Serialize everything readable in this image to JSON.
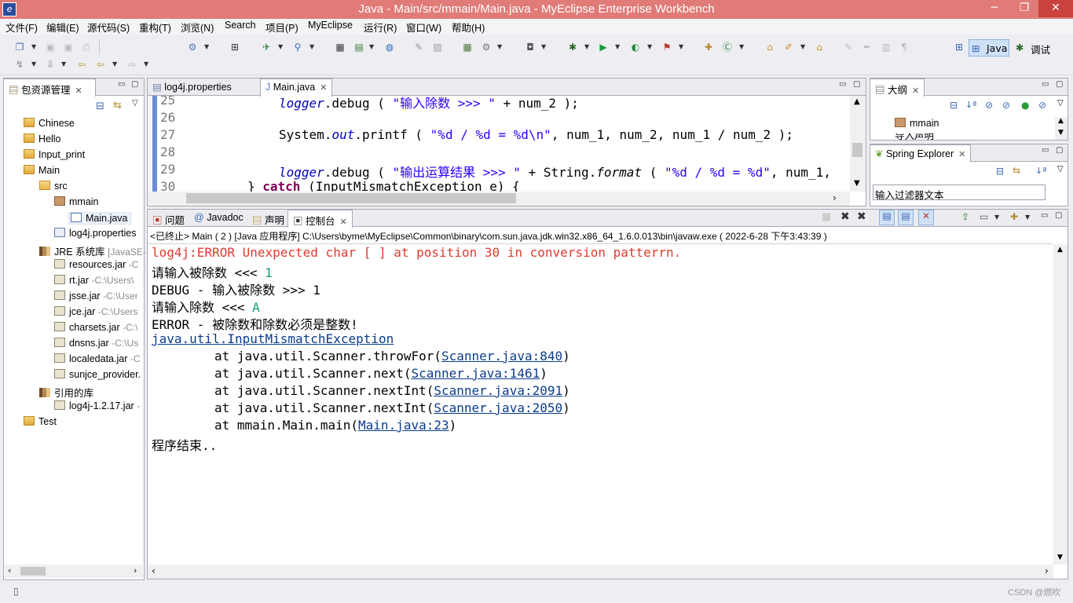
{
  "window": {
    "title": "Java  -  Main/src/mmain/Main.java  -  MyEclipse Enterprise Workbench",
    "min": "─",
    "max": "❐",
    "close": "✕"
  },
  "menu": [
    "文件(F)",
    "编辑(E)",
    "源代码(S)",
    "重构(T)",
    "浏览(N)",
    "Search",
    "项目(P)",
    "MyEclipse",
    "运行(R)",
    "窗口(W)",
    "帮助(H)"
  ],
  "perspectives": {
    "java": "Java",
    "debug": "调试"
  },
  "package_explorer": {
    "tab": "包资源管理",
    "items": [
      {
        "label": "Chinese",
        "icon": "project-icon"
      },
      {
        "label": "Hello",
        "icon": "project-icon"
      },
      {
        "label": "Input_print",
        "icon": "project-icon"
      },
      {
        "label": "Main",
        "icon": "project-icon"
      },
      {
        "label": "src",
        "icon": "source-folder-icon"
      },
      {
        "label": "mmain",
        "icon": "package-icon"
      },
      {
        "label": "Main.java",
        "icon": "java-file-icon"
      },
      {
        "label": "log4j.properties",
        "icon": "properties-file-icon"
      },
      {
        "label": "JRE 系统库",
        "suffix": "[JavaSE-",
        "icon": "library-icon"
      },
      {
        "label": "resources.jar",
        "suffix": "-C",
        "icon": "jar-icon"
      },
      {
        "label": "rt.jar",
        "suffix": "-C:\\Users\\",
        "icon": "jar-icon"
      },
      {
        "label": "jsse.jar",
        "suffix": "-C:\\User",
        "icon": "jar-icon"
      },
      {
        "label": "jce.jar",
        "suffix": "-C:\\Users",
        "icon": "jar-icon"
      },
      {
        "label": "charsets.jar",
        "suffix": "-C:\\",
        "icon": "jar-icon"
      },
      {
        "label": "dnsns.jar",
        "suffix": "-C:\\Us",
        "icon": "jar-icon"
      },
      {
        "label": "localedata.jar",
        "suffix": "-C",
        "icon": "jar-icon"
      },
      {
        "label": "sunjce_provider.",
        "suffix": "",
        "icon": "jar-icon"
      },
      {
        "label": "引用的库",
        "icon": "library-icon"
      },
      {
        "label": "log4j-1.2.17.jar",
        "suffix": "-",
        "icon": "jar-icon"
      },
      {
        "label": "Test",
        "icon": "project-icon"
      }
    ]
  },
  "editor": {
    "tabs": [
      "log4j.properties",
      "Main.java"
    ],
    "line_numbers": [
      "25",
      "26",
      "27",
      "28",
      "29",
      "30"
    ],
    "lines": {
      "l25_field": "logger",
      "l25_a": ".debug ( ",
      "l25_str": "\"输入除数 >>> \"",
      "l25_b": " + num_2 );",
      "l27_a": "System.",
      "l27_field": "out",
      "l27_b": ".printf ( ",
      "l27_str": "\"%d / %d = %d\\n\"",
      "l27_c": ", num_1, num_2, num_1 / num_2 );",
      "l29_field": "logger",
      "l29_a": ".debug ( ",
      "l29_str": "\"输出运算结果 >>> \"",
      "l29_b": " + String.",
      "l29_method": "format",
      "l29_c": " ( ",
      "l29_str2": "\"%d / %d = %d\"",
      "l29_d": ", num_1,",
      "l30_a": "} ",
      "l30_kw": "catch",
      "l30_b": " (InputMismatchException e) {"
    }
  },
  "outline": {
    "tab": "大纲",
    "item": "mmain",
    "item2": "导入声明"
  },
  "spring": {
    "tab": "Spring Explorer",
    "filter_placeholder": "输入过滤器文本"
  },
  "bottom_tabs": [
    "问题",
    "Javadoc",
    "声明",
    "控制台"
  ],
  "console": {
    "header": "<已终止> Main ( 2 ) [Java 应用程序] C:\\Users\\byme\\MyEclipse\\Common\\binary\\com.sun.java.jdk.win32.x86_64_1.6.0.013\\bin\\javaw.exe ( 2022-6-28 下午3:43:39 )",
    "l1": "log4j:ERROR Unexpected char [ ] at position 30 in conversion patterrn.",
    "l2_prompt": "请输入被除数 <<< ",
    "l2_input": "1",
    "l3": "DEBUG - 输入被除数 >>> 1",
    "l4_prompt": "请输入除数 <<< ",
    "l4_input": "A",
    "l5": "ERROR - 被除数和除数必须是整数!",
    "l6": "java.util.InputMismatchException",
    "trace": [
      {
        "pre": "\tat java.util.Scanner.throwFor(",
        "link": "Scanner.java:840",
        "post": ")"
      },
      {
        "pre": "\tat java.util.Scanner.next(",
        "link": "Scanner.java:1461",
        "post": ")"
      },
      {
        "pre": "\tat java.util.Scanner.nextInt(",
        "link": "Scanner.java:2091",
        "post": ")"
      },
      {
        "pre": "\tat java.util.Scanner.nextInt(",
        "link": "Scanner.java:2050",
        "post": ")"
      },
      {
        "pre": "\tat mmain.Main.main(",
        "link": "Main.java:23",
        "post": ")"
      }
    ],
    "end": "程序结束.."
  },
  "watermark": "CSDN @燃吹"
}
